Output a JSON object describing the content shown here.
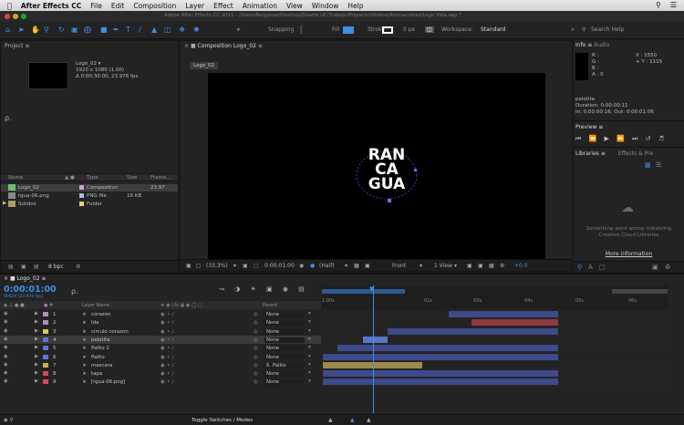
{
  "menubar": {
    "app": "After Effects CC",
    "items": [
      "File",
      "Edit",
      "Composition",
      "Layer",
      "Effect",
      "Animation",
      "View",
      "Window",
      "Help"
    ]
  },
  "window_title": "Adobe After Effects CC 2015 - /Users/Nsrpassa/Desktop/Dearte UC/Trabajo/Proyecto/Videos/Animaciones/Logo Vida.aep *",
  "toolbar": {
    "snapping": "Snapping",
    "fill": "Fill",
    "stroke": "Stroke",
    "stroke_width": "0 px",
    "workspace_label": "Workspace:",
    "workspace": "Standard",
    "search_placeholder": "Search Help"
  },
  "project": {
    "tab": "Project",
    "comp_name": "Logo_02 ▾",
    "comp_info_1": "1920 x 1080 (1.00)",
    "comp_info_2": "Δ 0:00:30:00, 23.976 fps",
    "search_glyph": "ρ.",
    "col_name": "Name",
    "col_type": "Type",
    "col_size": "Size",
    "col_frame": "Frame...",
    "items": [
      {
        "name": "Logo_02",
        "type": "Composition",
        "size": "",
        "frame": "23.97"
      },
      {
        "name": "rgua-06.png",
        "type": "PNG file",
        "size": "16 KB",
        "frame": ""
      },
      {
        "name": "Solidos",
        "type": "Folder",
        "size": "",
        "frame": ""
      }
    ],
    "bpc": "8 bpc"
  },
  "composition": {
    "tab": "Composition Logo_02",
    "breadcrumb": "Logo_02",
    "logo_lines": [
      "RAN",
      "CA",
      "GUA"
    ],
    "zoom": "(33.3%)",
    "timecode": "0:00:01:00",
    "resolution": "(Half)",
    "view": "Front",
    "views": "1 View",
    "exposure": "+0.0"
  },
  "info": {
    "tab": "Info",
    "tab2": "Audio",
    "r": "R :",
    "g": "G :",
    "b": "B :",
    "a": "A : 0",
    "x": "X : 1550",
    "y": "+ Y : 1115",
    "layer": "pelotita",
    "duration": "Duration: 0:00:00:11",
    "inout": "In: 0:00:00:16, Out: 0:00:01:06"
  },
  "preview": {
    "tab": "Preview"
  },
  "libraries": {
    "tab": "Libraries",
    "tab2": "Effects & Pre",
    "message": "Something went wrong initializing Creative Cloud Libraries",
    "link": "More information"
  },
  "timeline": {
    "tab": "Logo_02",
    "timecode": "0:00:01:00",
    "frames": "00024 (23.976 fps)",
    "col_layer": "Layer Name",
    "col_parent": "Parent",
    "toggle": "Toggle Switches / Modes",
    "ticks": [
      "1:00s",
      "02s",
      "03s",
      "04s",
      "05s",
      "06s"
    ],
    "layers": [
      {
        "num": "1",
        "name": "corazon",
        "parent": "None"
      },
      {
        "num": "2",
        "name": "Ida",
        "parent": "None"
      },
      {
        "num": "3",
        "name": "circulo corazon",
        "parent": "None"
      },
      {
        "num": "4",
        "name": "pelotita",
        "parent": "None"
      },
      {
        "num": "5",
        "name": "Palito 2",
        "parent": "None"
      },
      {
        "num": "6",
        "name": "Palito",
        "parent": "None"
      },
      {
        "num": "7",
        "name": "mascara",
        "parent": "6. Palito"
      },
      {
        "num": "8",
        "name": "tapa",
        "parent": "None"
      },
      {
        "num": "9",
        "name": "[rgua-06.png]",
        "parent": "None"
      }
    ]
  },
  "colors": {
    "accent": "#3d8ee6",
    "playhead": "#3d8ee6",
    "panel": "#232323"
  }
}
